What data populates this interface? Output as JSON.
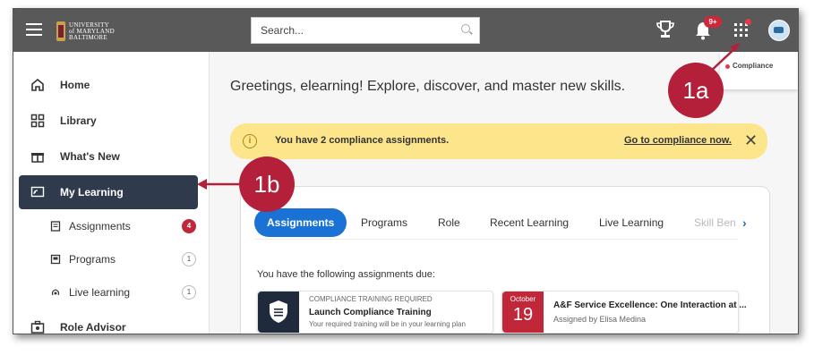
{
  "header": {
    "logo_text": [
      "UNIVERSITY",
      "of MARYLAND",
      "BALTIMORE"
    ],
    "search_placeholder": "Search...",
    "notifications_badge": "9+",
    "icons": [
      "menu-icon",
      "search-icon",
      "trophy-icon",
      "bell-icon",
      "apps-grid-icon",
      "avatar-icon"
    ]
  },
  "popup": {
    "label": "Compliance"
  },
  "sidebar": {
    "items": [
      {
        "label": "Home",
        "icon": "home-icon"
      },
      {
        "label": "Library",
        "icon": "library-icon"
      },
      {
        "label": "What's New",
        "icon": "gift-icon"
      },
      {
        "label": "My Learning",
        "icon": "learning-icon",
        "active": true
      },
      {
        "label": "Role Advisor",
        "icon": "role-advisor-icon"
      }
    ],
    "sub_items": [
      {
        "label": "Assignments",
        "count": "4"
      },
      {
        "label": "Programs",
        "count": "1"
      },
      {
        "label": "Live learning",
        "count": "1"
      }
    ]
  },
  "main": {
    "greeting": "Greetings, elearning! Explore, discover, and master new skills.",
    "alert": {
      "message": "You have 2 compliance assignments.",
      "link": "Go to compliance now.",
      "close": "✕"
    },
    "tabs": [
      "Assignments",
      "Programs",
      "Role",
      "Recent Learning",
      "Live Learning",
      "Skill Ben"
    ],
    "due_text": "You have the following assignments due:",
    "assignments": [
      {
        "caption": "COMPLIANCE TRAINING REQUIRED",
        "title": "Launch Compliance Training",
        "subtitle": "Your required training will be in your learning plan"
      },
      {
        "date_month": "October",
        "date_day": "19",
        "title": "A&F Service Excellence: One Interaction at ...",
        "subtitle": "Assigned by Elisa Medina"
      }
    ]
  },
  "annotations": {
    "marker_1": "1a",
    "marker_2": "1b"
  },
  "colors": {
    "accent": "#1a72d4",
    "annotation": "#b41f3a",
    "topbar": "#595959",
    "active_nav": "#2f3a4d",
    "alert": "#fce58a"
  }
}
